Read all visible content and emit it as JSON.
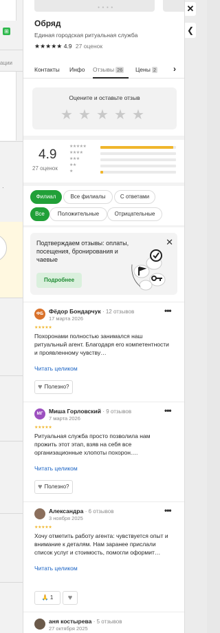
{
  "left_strip": {
    "partial_text": "ации"
  },
  "header": {
    "title": "Обряд",
    "subtitle": "Единая городская ритуальная служба",
    "stars": "★★★★★",
    "rating": "4.9",
    "rating_count": "27 оценок"
  },
  "tabs": [
    {
      "label": "Контакты"
    },
    {
      "label": "Инфо"
    },
    {
      "label": "Отзывы",
      "badge": "26",
      "active": true
    },
    {
      "label": "Цены",
      "badge": "2"
    }
  ],
  "rate_box": {
    "label": "Оцените и оставьте отзыв"
  },
  "summary": {
    "score": "4.9",
    "count": "27 оценок",
    "histogram": [
      {
        "stars": "★★★★★",
        "fraction": 0.96
      },
      {
        "stars": "★★★★",
        "fraction": 0.0
      },
      {
        "stars": "★★★",
        "fraction": 0.0
      },
      {
        "stars": "★★",
        "fraction": 0.0
      },
      {
        "stars": "★",
        "fraction": 0.04
      }
    ]
  },
  "filters": {
    "branch": [
      "Филиал",
      "Все филиалы",
      "С ответами"
    ],
    "sentiment": [
      "Все",
      "Положительные",
      "Отрицательные"
    ]
  },
  "promo": {
    "text": "Подтверждаем отзывы: оплаты, посещения, бронирования и чаевые",
    "button": "Подробнее"
  },
  "reviews": [
    {
      "initials": "ФБ",
      "avatar_color": "#d9722b",
      "name": "Фёдор Бондарчук",
      "count": "· 12 отзывов",
      "date": "17 марта 2026",
      "stars": "★★★★★",
      "text": "Похоронами полностью занимался наш ритуальный агент. Благодаря его компетентности и проявленному чувству…",
      "more": "Читать целиком",
      "helpful": "Полезно?"
    },
    {
      "initials": "МГ",
      "avatar_color": "#9c4fbf",
      "name": "Миша Горловский",
      "count": "· 9 отзывов",
      "date": "7 марта 2026",
      "stars": "★★★★★",
      "text": "Ритуальная служба просто позволила нам прожить этот этап, взяв на себя все организационные хлопоты похорон.…",
      "more": "Читать целиком",
      "helpful": "Полезно?"
    },
    {
      "initials": "",
      "avatar_color": "#8b6f5c",
      "name": "Александра",
      "count": "· 6 отзывов",
      "date": "3 ноября 2025",
      "stars": "★★★★★",
      "text": "Хочу отметить работу агента: чувствуется опыт и внимание к деталям. Нам заранее прислали список услуг и стоимость, помогли оформит…",
      "more": "Читать целиком",
      "reaction_count": "1"
    },
    {
      "initials": "",
      "avatar_color": "#6b5a4a",
      "name": "аня костырева",
      "count": "· 5 отзывов",
      "date": "27 октября 2025"
    }
  ]
}
